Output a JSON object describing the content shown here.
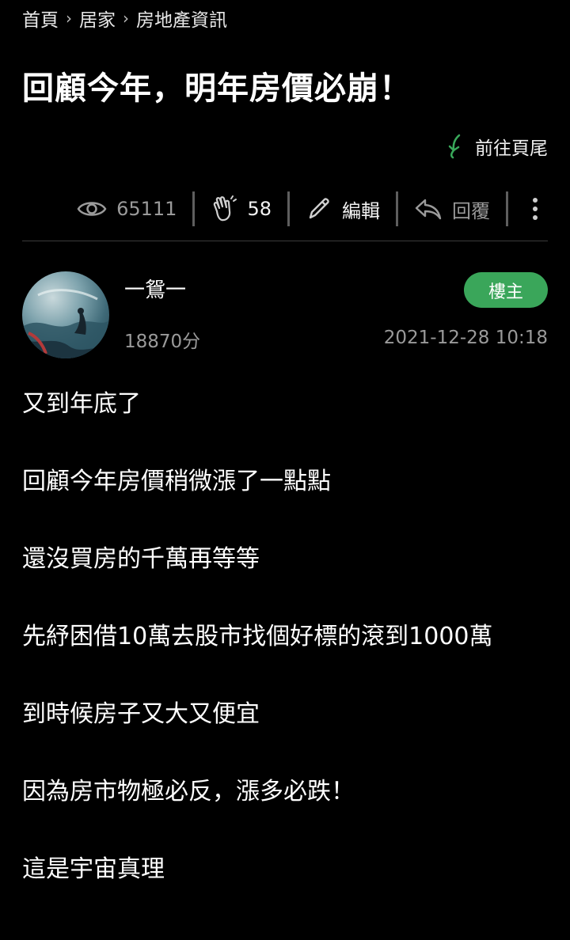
{
  "breadcrumb": {
    "items": [
      "首頁",
      "居家",
      "房地產資訊"
    ],
    "separator": "›"
  },
  "post": {
    "title": "回顧今年，明年房價必崩！",
    "goto_bottom_label": "前往頁尾"
  },
  "toolbar": {
    "views": "65111",
    "likes": "58",
    "edit_label": "編輯",
    "reply_label": "回覆"
  },
  "author": {
    "name": "一鴛一",
    "score": "18870分",
    "badge": "樓主",
    "timestamp": "2021-12-28 10:18"
  },
  "content": {
    "paragraphs": [
      "又到年底了",
      "回顧今年房價稍微漲了一點點",
      "還沒買房的千萬再等等",
      "先紓困借10萬去股市找個好標的滾到1000萬",
      "到時候房子又大又便宜",
      "因為房市物極必反，漲多必跌！",
      "這是宇宙真理"
    ]
  },
  "colors": {
    "background": "#000000",
    "accent_green": "#3aa65a",
    "muted_text": "#9a9a9a"
  },
  "icons": {
    "views": "eye-icon",
    "likes": "clap-hands-icon",
    "edit": "pencil-icon",
    "reply": "reply-arrow-icon",
    "more": "more-vertical-icon",
    "goto_bottom": "down-arrow-icon"
  }
}
